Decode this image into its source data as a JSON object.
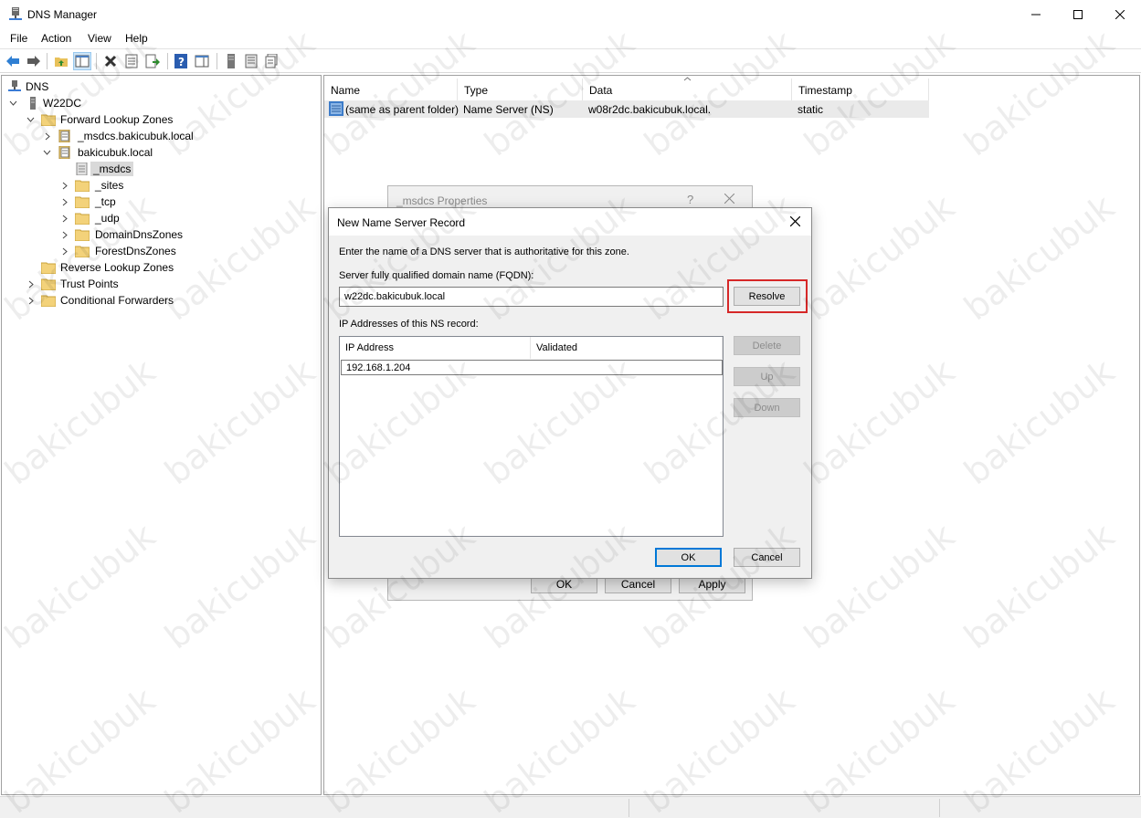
{
  "window": {
    "title": "DNS Manager",
    "icon": "dns-server-icon",
    "controls": [
      "minimize-icon",
      "maximize-icon",
      "close-icon"
    ]
  },
  "menu": {
    "items": [
      {
        "label": "File"
      },
      {
        "label": "Action"
      },
      {
        "label": "View"
      },
      {
        "label": "Help"
      }
    ]
  },
  "toolbar": {
    "buttons": [
      "back-arrow-icon",
      "forward-arrow-icon",
      "up-folder-icon",
      "show-hide-tree-icon",
      "delete-icon",
      "properties-icon",
      "export-list-icon",
      "help-icon",
      "action-pane-icon",
      "server-icon",
      "zone-icon",
      "record-icon"
    ]
  },
  "tree": {
    "root": "DNS",
    "server": "W22DC",
    "forward_zones": "Forward Lookup Zones",
    "zone_msdcs": "_msdcs.bakicubuk.local",
    "zone_main": "bakicubuk.local",
    "sub_msdcs": "_msdcs",
    "sub_sites": "_sites",
    "sub_tcp": "_tcp",
    "sub_udp": "_udp",
    "sub_domaindns": "DomainDnsZones",
    "sub_forestdns": "ForestDnsZones",
    "reverse_zones": "Reverse Lookup Zones",
    "trust_points": "Trust Points",
    "conditional_forwarders": "Conditional Forwarders"
  },
  "list": {
    "columns": [
      "Name",
      "Type",
      "Data",
      "Timestamp"
    ],
    "rows": [
      {
        "name": "(same as parent folder)",
        "type": "Name Server (NS)",
        "data": "w08r2dc.bakicubuk.local.",
        "timestamp": "static"
      }
    ]
  },
  "props_dialog": {
    "title": "_msdcs Properties",
    "help": "?",
    "ok": "OK",
    "cancel": "Cancel",
    "apply": "Apply"
  },
  "ns_dialog": {
    "title": "New Name Server Record",
    "instruction": "Enter the name of a DNS server that is authoritative for this zone.",
    "fqdn_label": "Server fully qualified domain name (FQDN):",
    "fqdn_value": "w22dc.bakicubuk.local",
    "resolve": "Resolve",
    "ip_label": "IP Addresses of this NS record:",
    "ip_columns": [
      "IP Address",
      "Validated"
    ],
    "ip_rows": [
      {
        "ip": "192.168.1.204",
        "validated": ""
      }
    ],
    "delete": "Delete",
    "up": "Up",
    "down": "Down",
    "ok": "OK",
    "cancel": "Cancel",
    "highlight_color": "#d62828"
  },
  "watermark": "bakicubuk"
}
